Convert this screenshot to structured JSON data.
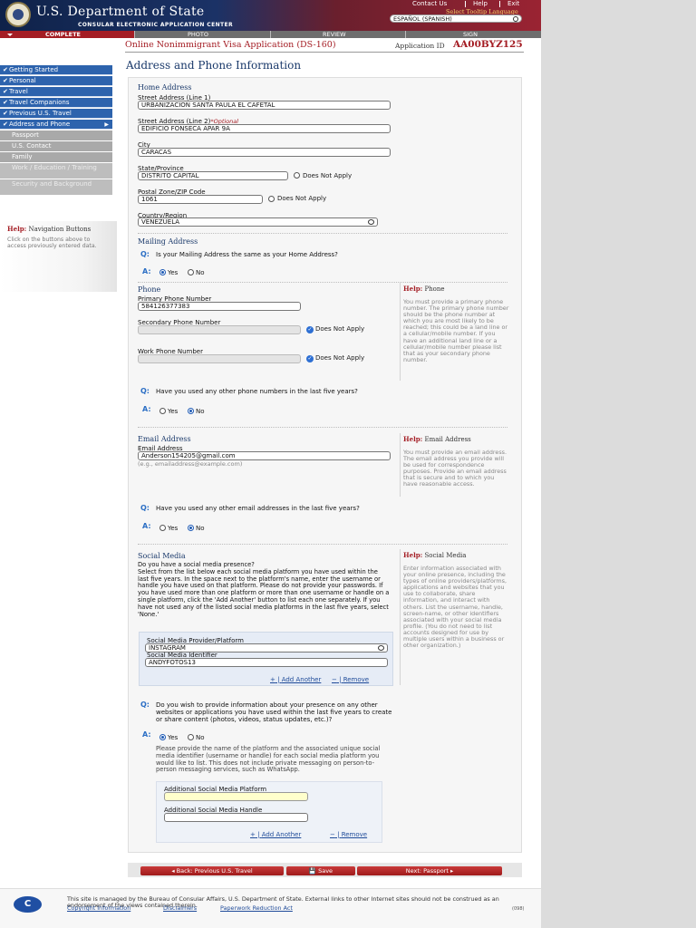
{
  "header": {
    "title": "U.S. Department of State",
    "subtitle": "CONSULAR ELECTRONIC APPLICATION CENTER",
    "links": [
      "Contact Us",
      "Help",
      "Exit"
    ],
    "language_label": "Select Tooltip Language",
    "language_value": "ESPAÑOL (SPANISH)"
  },
  "progress": {
    "steps": [
      "COMPLETE",
      "PHOTO",
      "REVIEW",
      "SIGN"
    ]
  },
  "app": {
    "form_title": "Online Nonimmigrant Visa Application (DS-160)",
    "id_label": "Application ID",
    "id_value": "AA00BYZ125",
    "page_title": "Address and Phone Information"
  },
  "sidebar": {
    "items": [
      "Getting Started",
      "Personal",
      "Travel",
      "Travel Companions",
      "Previous U.S. Travel",
      "Address and Phone"
    ],
    "subitems": [
      "Passport",
      "U.S. Contact",
      "Family",
      "Work / Education / Training",
      "Security and Background"
    ],
    "help_title": "Navigation Buttons",
    "help_text": "Click on the buttons above to access previously entered data."
  },
  "home": {
    "heading": "Home Address",
    "street1_label": "Street Address (Line 1)",
    "street1": "URBANIZACION SANTA PAULA EL CAFETAL",
    "street2_label": "Street Address (Line 2)",
    "optional": "*Optional",
    "street2": "EDIFICIO FONSECA APAR 9A",
    "city_label": "City",
    "city": "CARACAS",
    "state_label": "State/Province",
    "state": "DISTRITO CAPITAL",
    "does_not_apply": "Does Not Apply",
    "zip_label": "Postal Zone/ZIP Code",
    "zip": "1061",
    "country_label": "Country/Region",
    "country": "VENEZUELA"
  },
  "mailing": {
    "heading": "Mailing Address",
    "question": "Is your Mailing Address the same as your Home Address?",
    "yes": "Yes",
    "no": "No"
  },
  "phone": {
    "heading": "Phone",
    "primary_label": "Primary Phone Number",
    "primary": "584126377383",
    "secondary_label": "Secondary Phone Number",
    "work_label": "Work Phone Number",
    "does_not_apply": "Does Not Apply",
    "question": "Have you used any other phone numbers in the last five years?",
    "yes": "Yes",
    "no": "No",
    "help_title": "Phone",
    "help_text": "You must provide a primary phone number. The primary phone number should be the phone number at which you are most likely to be reached; this could be a land line or a cellular/mobile number. If you have an additional land line or a cellular/mobile number please list that as your secondary phone number."
  },
  "email": {
    "heading": "Email Address",
    "label": "Email Address",
    "value": "Anderson154205@gmail.com",
    "example": "(e.g., emailaddress@example.com)",
    "question": "Have you used any other email addresses in the last five years?",
    "yes": "Yes",
    "no": "No",
    "help_title": "Email Address",
    "help_text": "You must provide an email address. The email address you provide will be used for correspondence purposes. Provide an email address that is secure and to which you have reasonable access."
  },
  "social": {
    "heading": "Social Media",
    "question_bold": "Do you have a social media presence?",
    "text": "Select from the list below each social media platform you have used within the last five years. In the space next to the platform's name, enter the username or handle you have used on that platform. Please do not provide your passwords. If you have used more than one platform or more than one username or handle on a single platform, click the 'Add Another' button to list each one separately. If you have not used any of the listed social media platforms in the last five years, select 'None.'",
    "provider_label": "Social Media Provider/Platform",
    "provider": "INSTAGRAM",
    "id_label": "Social Media Identifier",
    "identifier": "ANDYFOTOS13",
    "add": "Add Another",
    "remove": "Remove",
    "help_title": "Social Media",
    "help_text": "Enter information associated with your online presence, including the types of online providers/platforms, applications and websites that you use to collaborate, share information, and interact with others. List the username, handle, screen-name, or other identifiers associated with your social media profile. (You do not need to list accounts designed for use by multiple users within a business or other organization.)"
  },
  "other": {
    "question": "Do you wish to provide information about your presence on any other websites or applications you have used within the last five years to create or share content (photos, videos, status updates, etc.)?",
    "yes": "Yes",
    "no": "No",
    "text": "Please provide the name of the platform and the associated unique social media identifier (username or handle) for each social media platform you would like to list. This does not include private messaging on person-to-person messaging services, such as WhatsApp.",
    "platform_label": "Additional Social Media Platform",
    "handle_label": "Additional Social Media Handle",
    "add": "Add Another",
    "remove": "Remove"
  },
  "labels": {
    "help": "Help:",
    "q": "Q:",
    "a": "A:"
  },
  "buttons": {
    "back": "◂ Back: Previous U.S. Travel",
    "save": "Save",
    "next": "Next: Passport ▸"
  },
  "footer": {
    "logo": "C",
    "text": "This site is managed by the Bureau of Consular Affairs, U.S. Department of State. External links to other Internet sites should not be construed as an endorsement of the views contained therein.",
    "links": [
      "Copyright Information",
      "Disclaimers",
      "Paperwork Reduction Act"
    ],
    "version": "(098)"
  }
}
